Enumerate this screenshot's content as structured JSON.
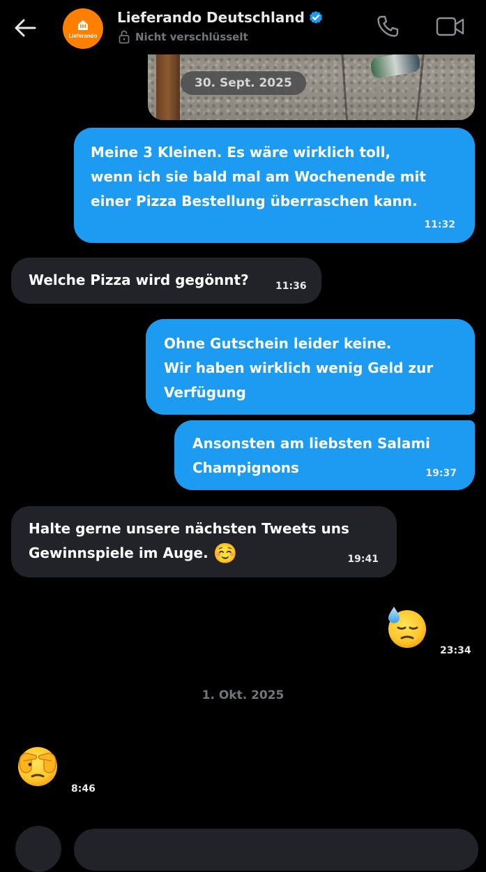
{
  "header": {
    "back_label": "back",
    "avatar_logo_text": "Lieferando",
    "title": "Lieferando Deutschland",
    "verified": true,
    "encryption_status": "Nicht verschlüsselt",
    "icons": [
      "back-arrow-icon",
      "lock-icon",
      "verified-badge-icon",
      "phone-icon",
      "video-camera-icon"
    ]
  },
  "image_message": {
    "date_chip": "30. Sept. 2025"
  },
  "messages": [
    {
      "direction": "sent",
      "text": "Meine 3 Kleinen. Es wäre wirklich toll,\nwenn ich sie bald mal am Wochenende mit\neiner Pizza Bestellung überraschen kann.",
      "time": "11:32"
    },
    {
      "direction": "received",
      "text": "Welche Pizza wird gegönnt?",
      "time": "11:36"
    },
    {
      "direction": "sent",
      "text": "Ohne Gutschein leider keine.\nWir haben wirklich wenig Geld zur\nVerfügung",
      "time": ""
    },
    {
      "direction": "sent",
      "text": "Ansonsten am liebsten Salami\nChampignons",
      "time": "19:37"
    },
    {
      "direction": "received",
      "text": "Halte gerne unsere nächsten Tweets uns\nGewinnspiele im Auge.",
      "emoji": "☺️",
      "time": "19:41"
    },
    {
      "direction": "sent",
      "emoji": "😓",
      "time": "23:34"
    }
  ],
  "day_divider": "1. Okt. 2025",
  "later_messages": [
    {
      "direction": "received",
      "emoji": "🫣",
      "time": "8:46"
    }
  ],
  "colors": {
    "background": "#000000",
    "sent_bubble": "#1d9bf0",
    "received_bubble": "#202327",
    "secondary_text": "#71767b",
    "brand_orange": "#ff8000",
    "verified_blue": "#1d9bf0"
  }
}
